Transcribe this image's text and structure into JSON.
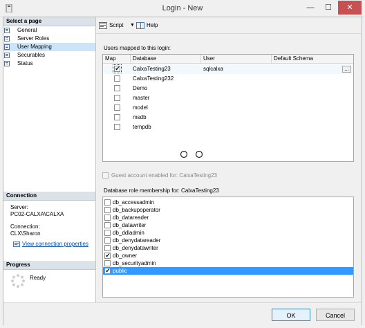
{
  "window": {
    "title": "Login - New",
    "minimize": "—",
    "maximize": "☐",
    "close": "✕"
  },
  "sidebar": {
    "header": "Select a page",
    "items": [
      {
        "label": "General",
        "selected": false
      },
      {
        "label": "Server Roles",
        "selected": false
      },
      {
        "label": "User Mapping",
        "selected": true
      },
      {
        "label": "Securables",
        "selected": false
      },
      {
        "label": "Status",
        "selected": false
      }
    ],
    "connection": {
      "header": "Connection",
      "server_label": "Server:",
      "server_value": "PC02-CALXA\\CALXA",
      "connection_label": "Connection:",
      "connection_value": "CLX\\Sharon",
      "link": "View connection properties"
    },
    "progress": {
      "header": "Progress",
      "status": "Ready"
    }
  },
  "toolbar": {
    "script_label": "Script",
    "help_label": "Help"
  },
  "users_section": {
    "label": "Users mapped to this login:",
    "columns": [
      "Map",
      "Database",
      "User",
      "Default Schema"
    ],
    "rows": [
      {
        "map": true,
        "database": "CalxaTesting23",
        "user": "sqlcalxa",
        "schema": "",
        "ellipsis": "..."
      },
      {
        "map": false,
        "database": "CalxaTesting232",
        "user": "",
        "schema": ""
      },
      {
        "map": false,
        "database": "Demo",
        "user": "",
        "schema": ""
      },
      {
        "map": false,
        "database": "master",
        "user": "",
        "schema": ""
      },
      {
        "map": false,
        "database": "model",
        "user": "",
        "schema": ""
      },
      {
        "map": false,
        "database": "msdb",
        "user": "",
        "schema": ""
      },
      {
        "map": false,
        "database": "tempdb",
        "user": "",
        "schema": ""
      }
    ]
  },
  "guest": {
    "label": "Guest account enabled for: CalxaTesting23",
    "checked": false
  },
  "roles_section": {
    "label": "Database role membership for: CalxaTesting23",
    "roles": [
      {
        "name": "db_accessadmin",
        "checked": false,
        "selected": false
      },
      {
        "name": "db_backupoperator",
        "checked": false,
        "selected": false
      },
      {
        "name": "db_datareader",
        "checked": false,
        "selected": false
      },
      {
        "name": "db_datawriter",
        "checked": false,
        "selected": false
      },
      {
        "name": "db_ddladmin",
        "checked": false,
        "selected": false
      },
      {
        "name": "db_denydatareader",
        "checked": false,
        "selected": false
      },
      {
        "name": "db_denydatawriter",
        "checked": false,
        "selected": false
      },
      {
        "name": "db_owner",
        "checked": true,
        "selected": false
      },
      {
        "name": "db_securityadmin",
        "checked": false,
        "selected": false
      },
      {
        "name": "public",
        "checked": true,
        "selected": true
      }
    ]
  },
  "buttons": {
    "ok": "OK",
    "cancel": "Cancel"
  }
}
